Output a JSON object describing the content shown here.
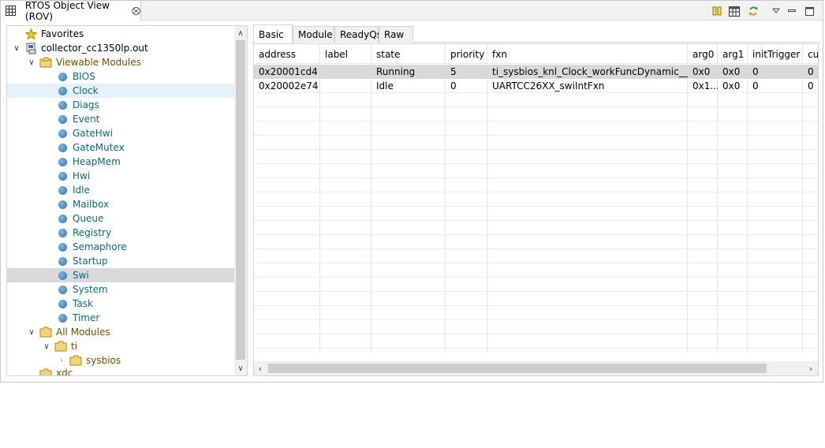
{
  "view": {
    "title": "RTOS Object View (ROV)",
    "close_glyph": "⨂"
  },
  "toolbar": {
    "icons": [
      "pause-icon",
      "table-icon",
      "refresh-icon",
      "view-menu-icon",
      "minimize-icon",
      "maximize-icon"
    ]
  },
  "tree": {
    "favorites": "Favorites",
    "root": "collector_cc1350lp.out",
    "viewable_modules": "Viewable Modules",
    "modules": [
      "BIOS",
      "Clock",
      "Diags",
      "Event",
      "GateHwi",
      "GateMutex",
      "HeapMem",
      "Hwi",
      "Idle",
      "Mailbox",
      "Queue",
      "Registry",
      "Semaphore",
      "Startup",
      "Swi",
      "System",
      "Task",
      "Timer"
    ],
    "hovered": "Clock",
    "selected": "Swi",
    "all_modules": "All Modules",
    "ti": "ti",
    "sysbios": "sysbios",
    "xdc": "xdc"
  },
  "tabs": [
    {
      "label": "Basic",
      "active": true
    },
    {
      "label": "Module",
      "active": false
    },
    {
      "label": "ReadyQs",
      "active": false
    },
    {
      "label": "Raw",
      "active": false
    }
  ],
  "table": {
    "columns": [
      "address",
      "label",
      "state",
      "priority",
      "fxn",
      "arg0",
      "arg1",
      "initTrigger",
      "cu"
    ],
    "rows": [
      [
        "0x20001cd4",
        "",
        "Running",
        "5",
        "ti_sysbios_knl_Clock_workFuncDynamic__E",
        "0x0",
        "0x0",
        "0",
        "0"
      ],
      [
        "0x20002e74",
        "",
        "Idle",
        "0",
        "UARTCC26XX_swiIntFxn",
        "0x1...",
        "0x0",
        "0",
        "0"
      ]
    ]
  }
}
